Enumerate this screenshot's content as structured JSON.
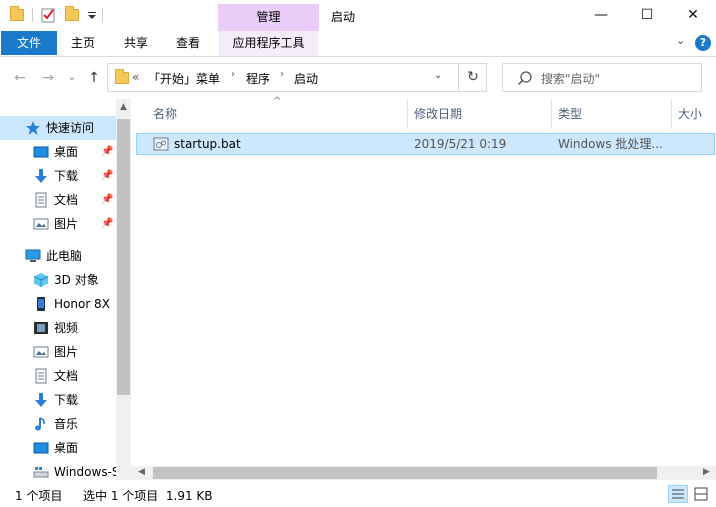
{
  "window": {
    "title": "启动",
    "manage_tab": "管理",
    "minimize": "—",
    "maximize": "☐",
    "close": "✕"
  },
  "ribbon": {
    "tabs": [
      "文件",
      "主页",
      "共享",
      "查看",
      "应用程序工具"
    ],
    "collapse_glyph": "⌄",
    "help_glyph": "?"
  },
  "address": {
    "overflow": "«",
    "crumbs": [
      "「开始」菜单",
      "程序",
      "启动"
    ],
    "separator": "›",
    "dropdown": "⌄",
    "refresh": "↻"
  },
  "search": {
    "placeholder": "搜索\"启动\""
  },
  "nav": {
    "back": "←",
    "forward": "→",
    "history": "⌄",
    "up": "↑",
    "items": [
      {
        "label": "快速访问",
        "icon": "star-icon"
      },
      {
        "label": "桌面",
        "icon": "desktop-icon",
        "pinned": true
      },
      {
        "label": "下载",
        "icon": "download-icon",
        "pinned": true
      },
      {
        "label": "文档",
        "icon": "document-icon",
        "pinned": true
      },
      {
        "label": "图片",
        "icon": "picture-icon",
        "pinned": true
      },
      {
        "label": "此电脑",
        "icon": "computer-icon"
      },
      {
        "label": "3D 对象",
        "icon": "3d-objects-icon"
      },
      {
        "label": "Honor 8X",
        "icon": "phone-icon"
      },
      {
        "label": "视频",
        "icon": "video-icon"
      },
      {
        "label": "图片",
        "icon": "picture-icon"
      },
      {
        "label": "文档",
        "icon": "document-icon"
      },
      {
        "label": "下载",
        "icon": "download-icon"
      },
      {
        "label": "音乐",
        "icon": "music-icon"
      },
      {
        "label": "桌面",
        "icon": "desktop-icon"
      },
      {
        "label": "Windows-S",
        "icon": "drive-icon"
      }
    ],
    "pin_glyph": "📌"
  },
  "columns": [
    "名称",
    "修改日期",
    "类型",
    "大小"
  ],
  "files": [
    {
      "name": "startup.bat",
      "modified": "2019/5/21 0:19",
      "type": "Windows 批处理..."
    }
  ],
  "status": {
    "item_count": "1 个项目",
    "selection": "选中 1 个项目  1.91 KB"
  },
  "colors": {
    "accent": "#1979ca",
    "manage_tab": "#e9cdf6",
    "selection": "#cce8ff"
  }
}
